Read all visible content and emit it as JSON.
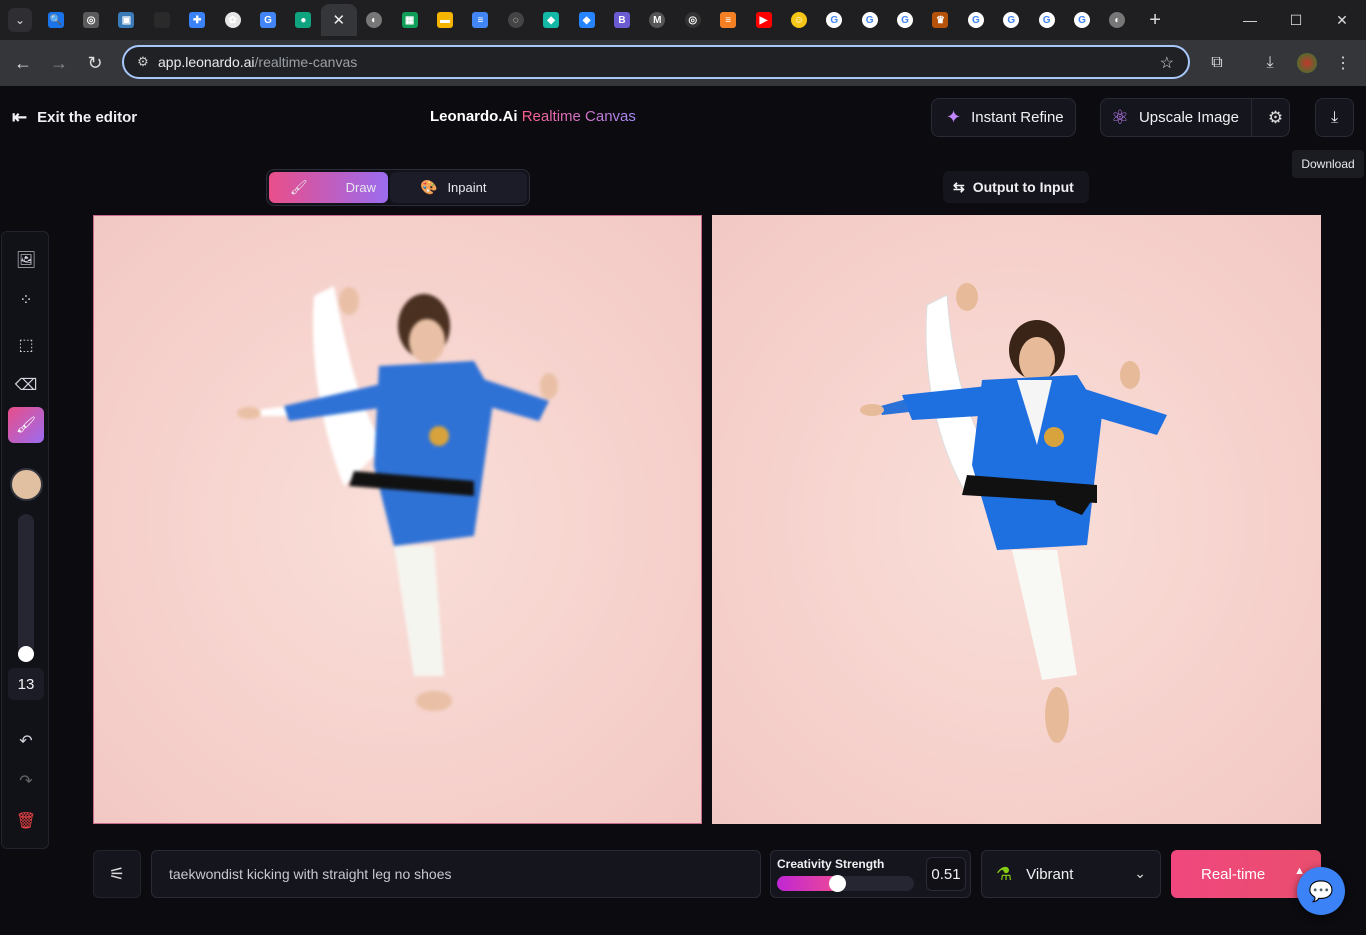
{
  "browser": {
    "tabs": [
      {
        "icon": "search-icon",
        "color": "#1a73e8",
        "glyph": "🔍"
      },
      {
        "icon": "chatgpt-icon",
        "color": "#5a5a5a",
        "glyph": "◎"
      },
      {
        "icon": "app-icon",
        "color": "#3a7ab8",
        "glyph": "▣"
      },
      {
        "icon": "blank-icon",
        "color": "#2a2a2a",
        "glyph": ""
      },
      {
        "icon": "puzzle-icon",
        "color": "#3b82f6",
        "glyph": "✚"
      },
      {
        "icon": "openai-icon",
        "color": "#e5e5e5",
        "glyph": "✿"
      },
      {
        "icon": "translate-icon",
        "color": "#4285f4",
        "glyph": "G"
      },
      {
        "icon": "leonardo-icon",
        "color": "#10a37f",
        "glyph": "●"
      },
      {
        "icon": "close-icon",
        "color": "#35363a",
        "glyph": "✕"
      },
      {
        "icon": "globe-icon",
        "color": "#777",
        "glyph": "◐"
      },
      {
        "icon": "sheets-icon",
        "color": "#0f9d58",
        "glyph": "▦"
      },
      {
        "icon": "slides-icon",
        "color": "#f4b400",
        "glyph": "▬"
      },
      {
        "icon": "docs-icon",
        "color": "#4285f4",
        "glyph": "≡"
      },
      {
        "icon": "circle-icon",
        "color": "#444",
        "glyph": "◌"
      },
      {
        "icon": "diamond-icon",
        "color": "#14b8a6",
        "glyph": "◆"
      },
      {
        "icon": "jira-icon",
        "color": "#2684ff",
        "glyph": "◆"
      },
      {
        "icon": "bold-b-icon",
        "color": "#6b5bd2",
        "glyph": "B"
      },
      {
        "icon": "medium-icon",
        "color": "#555",
        "glyph": "M"
      },
      {
        "icon": "openai-icon",
        "color": "#333",
        "glyph": "◎"
      },
      {
        "icon": "stack-icon",
        "color": "#f48024",
        "glyph": "≡"
      },
      {
        "icon": "youtube-icon",
        "color": "#ff0000",
        "glyph": "▶"
      },
      {
        "icon": "smile-icon",
        "color": "#f5c518",
        "glyph": "☺"
      },
      {
        "icon": "google-icon",
        "color": "#fff",
        "glyph": "G"
      },
      {
        "icon": "google-icon",
        "color": "#fff",
        "glyph": "G"
      },
      {
        "icon": "google-icon",
        "color": "#fff",
        "glyph": "G"
      },
      {
        "icon": "crown-icon",
        "color": "#b45309",
        "glyph": "♛"
      },
      {
        "icon": "google-icon",
        "color": "#fff",
        "glyph": "G"
      },
      {
        "icon": "google-icon",
        "color": "#fff",
        "glyph": "G"
      },
      {
        "icon": "google-icon",
        "color": "#fff",
        "glyph": "G"
      },
      {
        "icon": "google-icon",
        "color": "#fff",
        "glyph": "G"
      },
      {
        "icon": "globe-icon",
        "color": "#777",
        "glyph": "◐"
      }
    ],
    "url_host": "app.leonardo.ai",
    "url_path": "/realtime-canvas"
  },
  "header": {
    "exit_label": "Exit the editor",
    "brand_name": "Leonardo.Ai",
    "brand_product": "Realtime Canvas",
    "instant_refine": "Instant Refine",
    "upscale_image": "Upscale Image",
    "download_tooltip": "Download"
  },
  "modes": {
    "draw": "Draw",
    "inpaint": "Inpaint",
    "output_to_input": "Output to Input"
  },
  "tools": {
    "brush_size": "13"
  },
  "bottom": {
    "prompt": "taekwondist kicking with straight leg no shoes",
    "creativity_label": "Creativity Strength",
    "creativity_value": "0.51",
    "creativity_fraction": 0.51,
    "style": "Vibrant",
    "generate": "Real-time"
  },
  "colors": {
    "accent_pink": "#e94e89",
    "accent_purple": "#9b6cf0",
    "canvas_bg": "#f6d1cc",
    "brush_color": "#e0c0a0"
  }
}
